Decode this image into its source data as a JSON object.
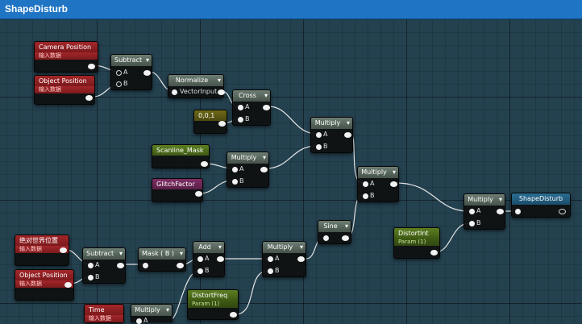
{
  "title": "ShapeDisturb",
  "nodes": {
    "cam_pos": {
      "title": "Camera Position",
      "subtitle": "输入数据"
    },
    "obj_pos_1": {
      "title": "Object Position",
      "subtitle": "输入数据"
    },
    "subtract_1": {
      "title": "Subtract",
      "pin_a": "A",
      "pin_b": "B"
    },
    "normalize": {
      "title": "Normalize",
      "input": "VectorInput"
    },
    "cross": {
      "title": "Cross",
      "pin_a": "A",
      "pin_b": "B"
    },
    "const_001": {
      "title": "0,0,1"
    },
    "multiply_1": {
      "title": "Multiply",
      "pin_a": "A",
      "pin_b": "B"
    },
    "scanline_mask": {
      "title": "Scanline_Mask"
    },
    "multiply_2": {
      "title": "Multiply",
      "pin_a": "A",
      "pin_b": "B"
    },
    "glitch_factor": {
      "title": "GlitchFactor"
    },
    "multiply_3": {
      "title": "Multiply",
      "pin_a": "A",
      "pin_b": "B"
    },
    "multiply_4": {
      "title": "Multiply",
      "pin_a": "A",
      "pin_b": "B"
    },
    "shape_disturb": {
      "title": "ShapeDisturb"
    },
    "distort_int": {
      "title": "DistortInt",
      "subtitle": "Param (1)"
    },
    "sine": {
      "title": "Sine"
    },
    "world_pos": {
      "title": "绝对世界位置",
      "subtitle": "输入数据"
    },
    "obj_pos_2": {
      "title": "Object Position",
      "subtitle": "输入数据"
    },
    "subtract_2": {
      "title": "Subtract",
      "pin_a": "A",
      "pin_b": "B"
    },
    "mask_b": {
      "title": "Mask ( B )"
    },
    "add": {
      "title": "Add",
      "pin_a": "A",
      "pin_b": "B"
    },
    "multiply_5": {
      "title": "Multiply",
      "pin_a": "A",
      "pin_b": "B"
    },
    "distort_freq": {
      "title": "DistortFreq",
      "subtitle": "Param (1)"
    },
    "time": {
      "title": "Time",
      "subtitle": "输入数据"
    },
    "multiply_6": {
      "title": "Multiply",
      "pin_a": "A"
    }
  },
  "icons": {
    "collapse": "chevron-down-icon"
  },
  "colors": {
    "titlebar": "#1f74c4",
    "input_red": "#a3262a",
    "param_green": "#5c7f22",
    "grid": "#24414f"
  }
}
